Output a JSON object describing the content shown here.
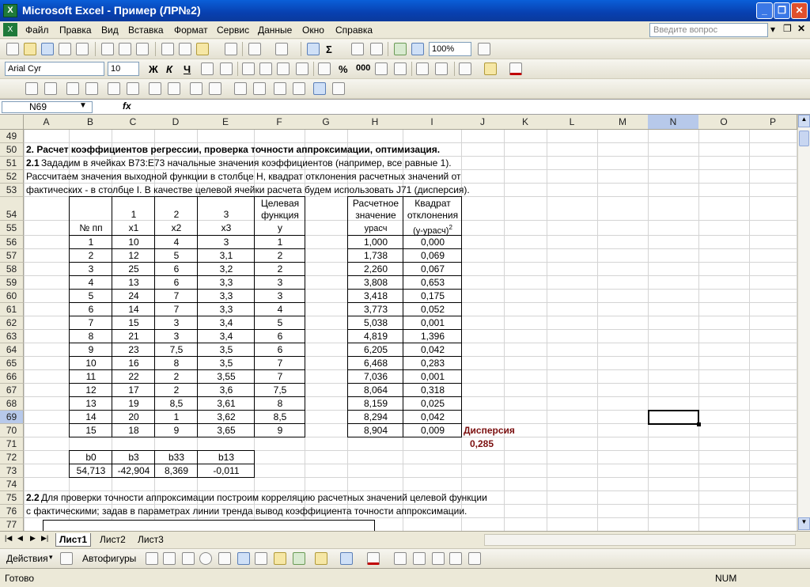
{
  "window": {
    "title": "Microsoft Excel - Пример (ЛР№2)",
    "app_icon": "X"
  },
  "menu": {
    "items": [
      "Файл",
      "Правка",
      "Вид",
      "Вставка",
      "Формат",
      "Сервис",
      "Данные",
      "Окно",
      "Справка"
    ],
    "question_placeholder": "Введите вопрос"
  },
  "toolbar": {
    "zoom": "100%",
    "font": "Arial Cyr",
    "font_size": "10",
    "bold": "Ж",
    "italic": "К",
    "underline": "Ч",
    "percent": "%",
    "thousands": "000",
    "sigma": "Σ"
  },
  "formula_bar": {
    "name_box": "N69",
    "fx": "fx",
    "formula": ""
  },
  "columns": [
    "A",
    "B",
    "C",
    "D",
    "E",
    "F",
    "G",
    "H",
    "I",
    "J",
    "K",
    "L",
    "M",
    "N",
    "O",
    "P"
  ],
  "selected_column": "N",
  "rows": [
    "49",
    "50",
    "51",
    "52",
    "53",
    "54",
    "55",
    "56",
    "57",
    "58",
    "59",
    "60",
    "61",
    "62",
    "63",
    "64",
    "65",
    "66",
    "67",
    "68",
    "69",
    "70",
    "71",
    "72",
    "73",
    "74",
    "75",
    "76",
    "77"
  ],
  "selected_row": "69",
  "text": {
    "r50": "2. Расчет коэффициентов регрессии, проверка точности аппроксимации, оптимизация.",
    "r51_num": "2.1",
    "r51": " Зададим в ячейках B73:E73 начальные значения коэффициентов (например, все равные 1).",
    "r52": "Рассчитаем значения выходной функции в столбце H, квадрат отклонения расчетных значений от",
    "r53": "фактических - в столбце I. В качестве целевой ячейки расчета будем использовать J71 (дисперсия).",
    "r75_num": "2.2",
    "r75": " Для проверки точности аппроксимации построим корреляцию расчетных значений целевой функции",
    "r76": "с фактическими; задав в параметрах линии тренда вывод коэффициента точности аппроксимации."
  },
  "table1": {
    "head_top": [
      "",
      "1",
      "2",
      "3"
    ],
    "target_l1": "Целевая",
    "target_l2": "функция",
    "head_bottom": [
      "№ пп",
      "x1",
      "x2",
      "x3",
      "y"
    ],
    "rows": [
      [
        "1",
        "10",
        "4",
        "3",
        "1"
      ],
      [
        "2",
        "12",
        "5",
        "3,1",
        "2"
      ],
      [
        "3",
        "25",
        "6",
        "3,2",
        "2"
      ],
      [
        "4",
        "13",
        "6",
        "3,3",
        "3"
      ],
      [
        "5",
        "24",
        "7",
        "3,3",
        "3"
      ],
      [
        "6",
        "14",
        "7",
        "3,3",
        "4"
      ],
      [
        "7",
        "15",
        "3",
        "3,4",
        "5"
      ],
      [
        "8",
        "21",
        "3",
        "3,4",
        "6"
      ],
      [
        "9",
        "23",
        "7,5",
        "3,5",
        "6"
      ],
      [
        "10",
        "16",
        "8",
        "3,5",
        "7"
      ],
      [
        "11",
        "22",
        "2",
        "3,55",
        "7"
      ],
      [
        "12",
        "17",
        "2",
        "3,6",
        "7,5"
      ],
      [
        "13",
        "19",
        "8,5",
        "3,61",
        "8"
      ],
      [
        "14",
        "20",
        "1",
        "3,62",
        "8,5"
      ],
      [
        "15",
        "18",
        "9",
        "3,65",
        "9"
      ]
    ]
  },
  "table2": {
    "h_l1": "Расчетное",
    "h_l2": "значение",
    "i_l1": "Квадрат",
    "i_l2": "отклонения",
    "h_sub": "yрасч",
    "i_sub": "(y-yрасч)",
    "i_sup": "2",
    "rows": [
      [
        "1,000",
        "0,000"
      ],
      [
        "1,738",
        "0,069"
      ],
      [
        "2,260",
        "0,067"
      ],
      [
        "3,808",
        "0,653"
      ],
      [
        "3,418",
        "0,175"
      ],
      [
        "3,773",
        "0,052"
      ],
      [
        "5,038",
        "0,001"
      ],
      [
        "4,819",
        "1,396"
      ],
      [
        "6,205",
        "0,042"
      ],
      [
        "6,468",
        "0,283"
      ],
      [
        "7,036",
        "0,001"
      ],
      [
        "8,064",
        "0,318"
      ],
      [
        "8,159",
        "0,025"
      ],
      [
        "8,294",
        "0,042"
      ],
      [
        "8,904",
        "0,009"
      ]
    ]
  },
  "dispersion": {
    "label": "Дисперсия",
    "value": "0,285"
  },
  "coef": {
    "headers": [
      "b0",
      "b3",
      "b33",
      "b13"
    ],
    "values": [
      "54,713",
      "-42,904",
      "8,369",
      "-0,011"
    ]
  },
  "sheets": [
    "Лист1",
    "Лист2",
    "Лист3"
  ],
  "drawing": {
    "actions": "Действия",
    "autoshapes": "Автофигуры"
  },
  "status": {
    "ready": "Готово",
    "num": "NUM"
  }
}
